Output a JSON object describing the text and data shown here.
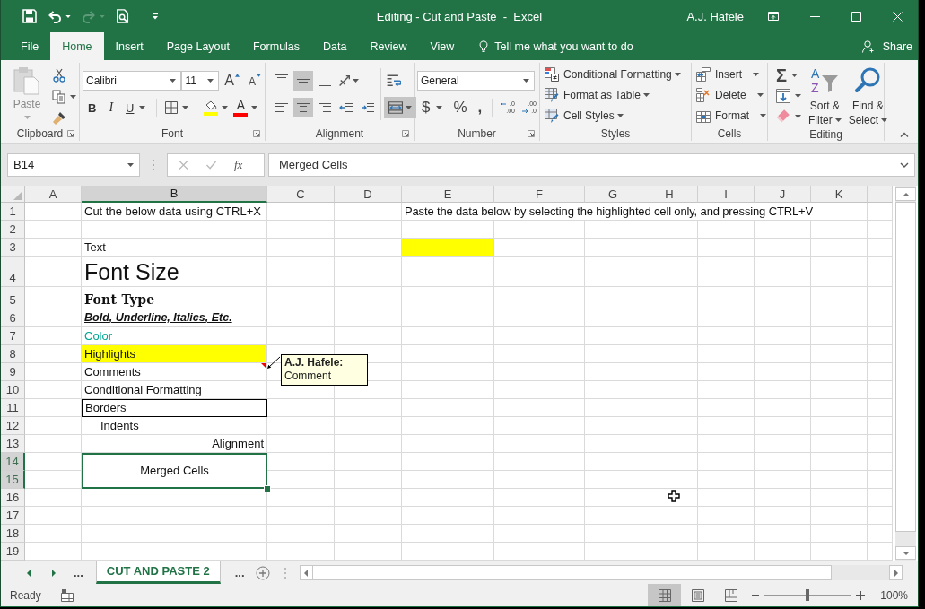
{
  "window": {
    "title": "Editing - Cut and Paste  -  Excel",
    "user": "A.J. Hafele"
  },
  "quick_access": [
    {
      "kind": "save",
      "disabled": false
    },
    {
      "kind": "undo",
      "disabled": false
    },
    {
      "kind": "redo",
      "disabled": true
    },
    {
      "kind": "preview",
      "disabled": false
    },
    {
      "kind": "customize",
      "disabled": false
    }
  ],
  "ribbon": {
    "tabs": [
      {
        "label": "File",
        "selected": false
      },
      {
        "label": "Home",
        "selected": true
      },
      {
        "label": "Insert",
        "selected": false
      },
      {
        "label": "Page Layout",
        "selected": false
      },
      {
        "label": "Formulas",
        "selected": false
      },
      {
        "label": "Data",
        "selected": false
      },
      {
        "label": "Review",
        "selected": false
      },
      {
        "label": "View",
        "selected": false
      }
    ],
    "tell_me": "Tell me what you want to do",
    "share": "Share",
    "clipboard": {
      "label": "Clipboard",
      "launcher": true,
      "paste": {
        "label": "Paste",
        "disabled": true
      }
    },
    "font": {
      "label": "Font",
      "launcher": true,
      "font_name": "Calibri",
      "font_size": "11",
      "grow": "A",
      "shrink": "A",
      "style_buttons": [
        {
          "kind": "bold",
          "label": "B"
        },
        {
          "kind": "italic",
          "label": "I"
        },
        {
          "kind": "underline",
          "label": "U"
        }
      ],
      "fill_color": {
        "color": "#ffff00"
      },
      "font_color": {
        "label": "A",
        "color": "#ff0000"
      }
    },
    "alignment": {
      "label": "Alignment",
      "launcher": true,
      "top_row": [
        {
          "kind": "top",
          "selected": false
        },
        {
          "kind": "middle",
          "selected": true
        },
        {
          "kind": "bottom",
          "selected": false
        },
        {
          "kind": "orientation",
          "selected": false
        }
      ],
      "bottom_row": [
        {
          "kind": "left",
          "selected": false
        },
        {
          "kind": "center",
          "selected": true
        },
        {
          "kind": "right",
          "selected": false
        },
        {
          "kind": "outdent",
          "selected": false
        },
        {
          "kind": "indent",
          "selected": false
        }
      ],
      "wrap": {
        "selected": false
      },
      "merge": {
        "selected": true
      }
    },
    "number": {
      "label": "Number",
      "launcher": true,
      "format": "General",
      "symbols": [
        {
          "kind": "currency",
          "label": "$"
        },
        {
          "kind": "percent",
          "label": "%"
        },
        {
          "kind": "comma",
          "label": ","
        }
      ],
      "decimals": [
        {
          "top": ".0",
          "bottom": ".00"
        },
        {
          "top": ".00",
          "bottom": ".0"
        }
      ]
    },
    "styles": {
      "label": "Styles",
      "items": [
        {
          "kind": "conditional",
          "label": "Conditional Formatting"
        },
        {
          "kind": "table",
          "label": "Format as Table"
        },
        {
          "kind": "cell",
          "label": "Cell Styles"
        }
      ]
    },
    "cells": {
      "label": "Cells",
      "items": [
        {
          "kind": "insert",
          "label": "Insert"
        },
        {
          "kind": "delete",
          "label": "Delete"
        },
        {
          "kind": "format",
          "label": "Format"
        }
      ]
    },
    "editing": {
      "label": "Editing",
      "autosum": "Σ",
      "sort": {
        "icon_letters": [
          "A",
          "Z"
        ],
        "lines": [
          "Sort &",
          "Filter"
        ]
      },
      "find": {
        "lines": [
          "Find &",
          "Select"
        ]
      }
    }
  },
  "formula_bar": {
    "name_box": "B14",
    "function_label": "fx",
    "value": "Merged Cells"
  },
  "sheet": {
    "columns": [
      {
        "label": "A",
        "selected": false
      },
      {
        "label": "B",
        "selected": true
      },
      {
        "label": "C",
        "selected": false
      },
      {
        "label": "D",
        "selected": false
      },
      {
        "label": "E",
        "selected": false
      },
      {
        "label": "F",
        "selected": false
      },
      {
        "label": "G",
        "selected": false
      },
      {
        "label": "H",
        "selected": false
      },
      {
        "label": "I",
        "selected": false
      },
      {
        "label": "J",
        "selected": false
      },
      {
        "label": "K",
        "selected": false
      }
    ],
    "rows": [
      {
        "label": "1",
        "selected": false,
        "cells": {
          "B": {
            "text": "Cut the below data using CTRL+X",
            "kind": "plain",
            "selected": false
          },
          "E": {
            "text": "Paste the data below by selecting the highlighted cell only, and pressing CTRL+V",
            "kind": "spill",
            "selected": false
          }
        }
      },
      {
        "label": "2",
        "selected": false,
        "cells": {}
      },
      {
        "label": "3",
        "selected": false,
        "cells": {
          "B": {
            "text": "Text",
            "kind": "plain",
            "selected": false
          },
          "E": {
            "kind": "highlighted",
            "selected": false
          }
        }
      },
      {
        "label": "4",
        "selected": false,
        "cells": {
          "B": {
            "text": "Font Size",
            "kind": "large",
            "selected": false
          }
        }
      },
      {
        "label": "5",
        "selected": false,
        "cells": {
          "B": {
            "text": "Font Type",
            "kind": "decorative",
            "selected": false
          }
        }
      },
      {
        "label": "6",
        "selected": false,
        "cells": {
          "B": {
            "text": "Bold, Underline, Italics, Etc.",
            "kind": "emphasis",
            "selected": false
          }
        }
      },
      {
        "label": "7",
        "selected": false,
        "cells": {
          "B": {
            "text": "Color",
            "kind": "colored",
            "selected": false
          }
        }
      },
      {
        "label": "8",
        "selected": false,
        "cells": {
          "B": {
            "text": "Highlights",
            "kind": "highlighted",
            "selected": false
          }
        }
      },
      {
        "label": "9",
        "selected": false,
        "cells": {
          "B": {
            "text": "Comments",
            "kind": "plain",
            "selected": false,
            "comment": {
              "author": "A.J. Hafele:",
              "text": "Comment"
            }
          }
        }
      },
      {
        "label": "10",
        "selected": false,
        "cells": {
          "B": {
            "text": "Conditional Formatting",
            "kind": "plain",
            "selected": false
          }
        }
      },
      {
        "label": "11",
        "selected": false,
        "cells": {
          "B": {
            "text": "Borders",
            "kind": "bordered",
            "selected": false
          }
        }
      },
      {
        "label": "12",
        "selected": false,
        "cells": {
          "B": {
            "text": "Indents",
            "kind": "indented",
            "selected": false
          }
        }
      },
      {
        "label": "13",
        "selected": false,
        "cells": {
          "B": {
            "text": "Alignment",
            "kind": "right",
            "selected": false
          }
        }
      },
      {
        "label": "14",
        "selected": true,
        "cells": {
          "B": {
            "text": "Merged Cells",
            "kind": "merged",
            "selected": true
          }
        }
      },
      {
        "label": "15",
        "selected": true,
        "cells": {}
      },
      {
        "label": "16",
        "selected": false,
        "cells": {}
      },
      {
        "label": "17",
        "selected": false,
        "cells": {}
      },
      {
        "label": "18",
        "selected": false,
        "cells": {}
      },
      {
        "label": "19",
        "selected": false,
        "cells": {}
      }
    ]
  },
  "sheet_tabs": {
    "overflow_left": "...",
    "tabs": [
      {
        "label": "CUT AND PASTE 2",
        "selected": true
      }
    ],
    "overflow_right": "..."
  },
  "status_bar": {
    "text": "Ready",
    "views": [
      {
        "kind": "normal",
        "selected": true
      },
      {
        "kind": "page_layout",
        "selected": false
      },
      {
        "kind": "page_break",
        "selected": false
      }
    ],
    "zoom": {
      "level": 0.5,
      "reading": "100%"
    }
  }
}
